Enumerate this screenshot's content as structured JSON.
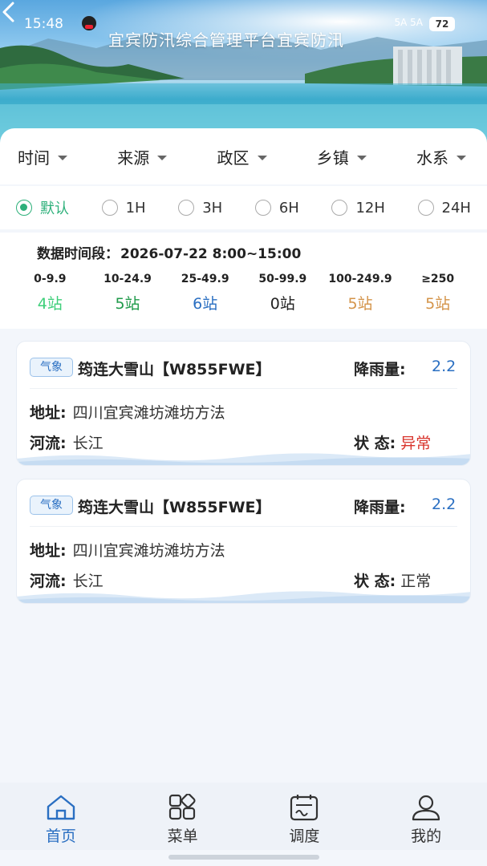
{
  "status_bar": {
    "time": "15:48",
    "signal": "5A 5A",
    "battery": "72"
  },
  "header": {
    "title": "宜宾防汛综合管理平台宜宾防汛"
  },
  "filters": [
    {
      "label": "时间"
    },
    {
      "label": "来源"
    },
    {
      "label": "政区"
    },
    {
      "label": "乡镇"
    },
    {
      "label": "水系"
    }
  ],
  "time_ranges": [
    {
      "label": "默认",
      "selected": true
    },
    {
      "label": "1H",
      "selected": false
    },
    {
      "label": "3H",
      "selected": false
    },
    {
      "label": "6H",
      "selected": false
    },
    {
      "label": "12H",
      "selected": false
    },
    {
      "label": "24H",
      "selected": false
    }
  ],
  "stats": {
    "period_label": "数据时间段：",
    "period_value": "2026-07-22 8:00~15:00",
    "ranges": [
      {
        "range": "0-9.9",
        "count": "4站",
        "color": "#3fcf7a"
      },
      {
        "range": "10-24.9",
        "count": "5站",
        "color": "#1f9a4a"
      },
      {
        "range": "25-49.9",
        "count": "6站",
        "color": "#2a6fc2"
      },
      {
        "range": "50-99.9",
        "count": "0站",
        "color": "#222222"
      },
      {
        "range": "100-249.9",
        "count": "5站",
        "color": "#d4944a"
      },
      {
        "range": "≥250",
        "count": "5站",
        "color": "#d4944a"
      }
    ]
  },
  "stations": [
    {
      "badge": "气象",
      "name": "筠连大雪山【W855FWE】",
      "rain_label": "降雨量:",
      "rain_value": "2.2",
      "address_label": "地址:",
      "address": "四川宜宾滩坊滩坊方法",
      "river_label": "河流:",
      "river": "长江",
      "status_label": "状 态:",
      "status": "异常",
      "status_color": "#d8342c"
    },
    {
      "badge": "气象",
      "name": "筠连大雪山【W855FWE】",
      "rain_label": "降雨量:",
      "rain_value": "2.2",
      "address_label": "地址:",
      "address": "四川宜宾滩坊滩坊方法",
      "river_label": "河流:",
      "river": "长江",
      "status_label": "状 态:",
      "status": "正常",
      "status_color": "#333333"
    }
  ],
  "nav": [
    {
      "label": "首页",
      "icon": "home-icon",
      "active": true
    },
    {
      "label": "菜单",
      "icon": "menu-grid-icon",
      "active": false
    },
    {
      "label": "调度",
      "icon": "dispatch-icon",
      "active": false
    },
    {
      "label": "我的",
      "icon": "profile-icon",
      "active": false
    }
  ]
}
